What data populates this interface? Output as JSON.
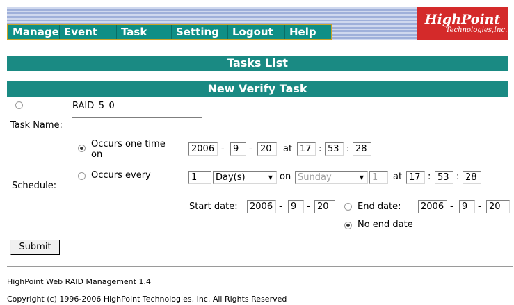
{
  "nav": {
    "items": [
      "Manage",
      "Event",
      "Task",
      "Setting",
      "Logout",
      "Help"
    ]
  },
  "logo": {
    "name": "HighPoint",
    "sub": "Technologies,Inc."
  },
  "tasks_list_title": "Tasks List",
  "new_task_title": "New Verify Task",
  "array": {
    "name": "RAID_5_0",
    "selected": false
  },
  "task_name": {
    "label": "Task Name:",
    "value": ""
  },
  "schedule": {
    "label": "Schedule:",
    "once": {
      "label_line1": "Occurs one time",
      "label_line2": "on",
      "selected": true,
      "year": "2006",
      "month": "9",
      "day": "20",
      "at": "at",
      "hour": "17",
      "minute": "53",
      "second": "28"
    },
    "every": {
      "label": "Occurs every",
      "selected": false,
      "count": "1",
      "unit": "Day(s)",
      "on": "on",
      "weekday": "Sunday",
      "weekday_index": "1",
      "at": "at",
      "hour": "17",
      "minute": "53",
      "second": "28"
    },
    "start_label": "Start date:",
    "start_year": "2006",
    "start_month": "9",
    "start_day": "20",
    "end_label": "End date:",
    "end_selected": false,
    "end_year": "2006",
    "end_month": "9",
    "end_day": "20",
    "no_end_label": "No end date",
    "no_end_selected": true
  },
  "submit_label": "Submit",
  "sep_dash": "-",
  "sep_colon": ":",
  "footer": {
    "version": "HighPoint Web RAID Management 1.4",
    "copyright": "Copyright (c) 1996-2006 HighPoint Technologies, Inc. All Rights Reserved"
  },
  "colors": {
    "teal": "#1a8a83",
    "logo_red": "#d42a2a"
  }
}
